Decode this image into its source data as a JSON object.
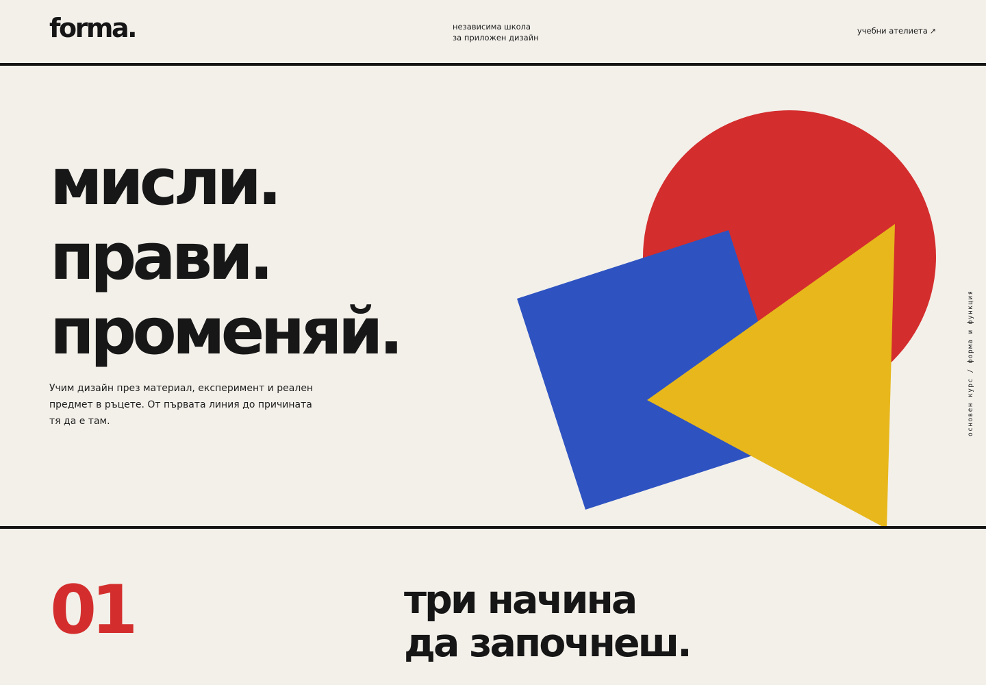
{
  "header": {
    "logo": "forma.",
    "tagline": {
      "line1": "независима школа",
      "line2": "за приложен дизайн"
    },
    "nav_link": "учебни ателиета",
    "nav_arrow": "↗"
  },
  "hero": {
    "title_lines": [
      "мисли.",
      "прави.",
      "променяй."
    ],
    "copy": "Учим дизайн през материал, експеримент и реален предмет в ръцете. От първата линия до причината тя да е там.",
    "side_label": "основен курс / форма и функция",
    "shapes": {
      "circle": {
        "name": "red-circle",
        "color": "#d42d2d"
      },
      "square": {
        "name": "blue-square",
        "color": "#2e53c1"
      },
      "triangle": {
        "name": "yellow-triangle",
        "color": "#e7b71c"
      }
    }
  },
  "section": {
    "number": "01",
    "title_lines": [
      "три начина",
      "да започнеш."
    ]
  }
}
